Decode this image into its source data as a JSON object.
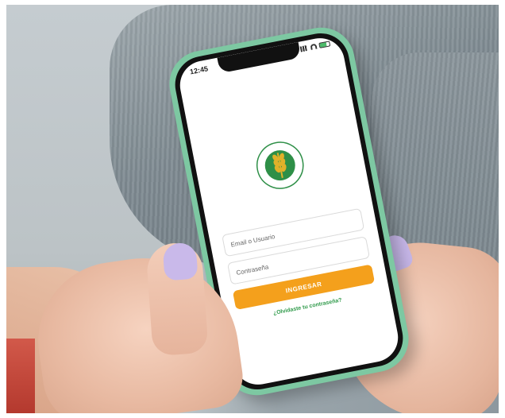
{
  "phone": {
    "status_time": "12:45",
    "logo_ring_text": "BANCO DE ALIMENTOS"
  },
  "login": {
    "email_placeholder": "Email o Usuario",
    "password_placeholder": "Contraseña",
    "submit_label": "INGRESAR",
    "forgot_link": "¿Olvidaste tu contraseña?"
  },
  "colors": {
    "phone_case": "#7dc8a2",
    "button": "#f4a01c",
    "link": "#2f9a4a",
    "logo_green": "#2e8f47",
    "logo_gold": "#e0b12a"
  },
  "icons": [
    "signal-icon",
    "wifi-icon",
    "battery-icon",
    "wheat-logo-icon"
  ]
}
